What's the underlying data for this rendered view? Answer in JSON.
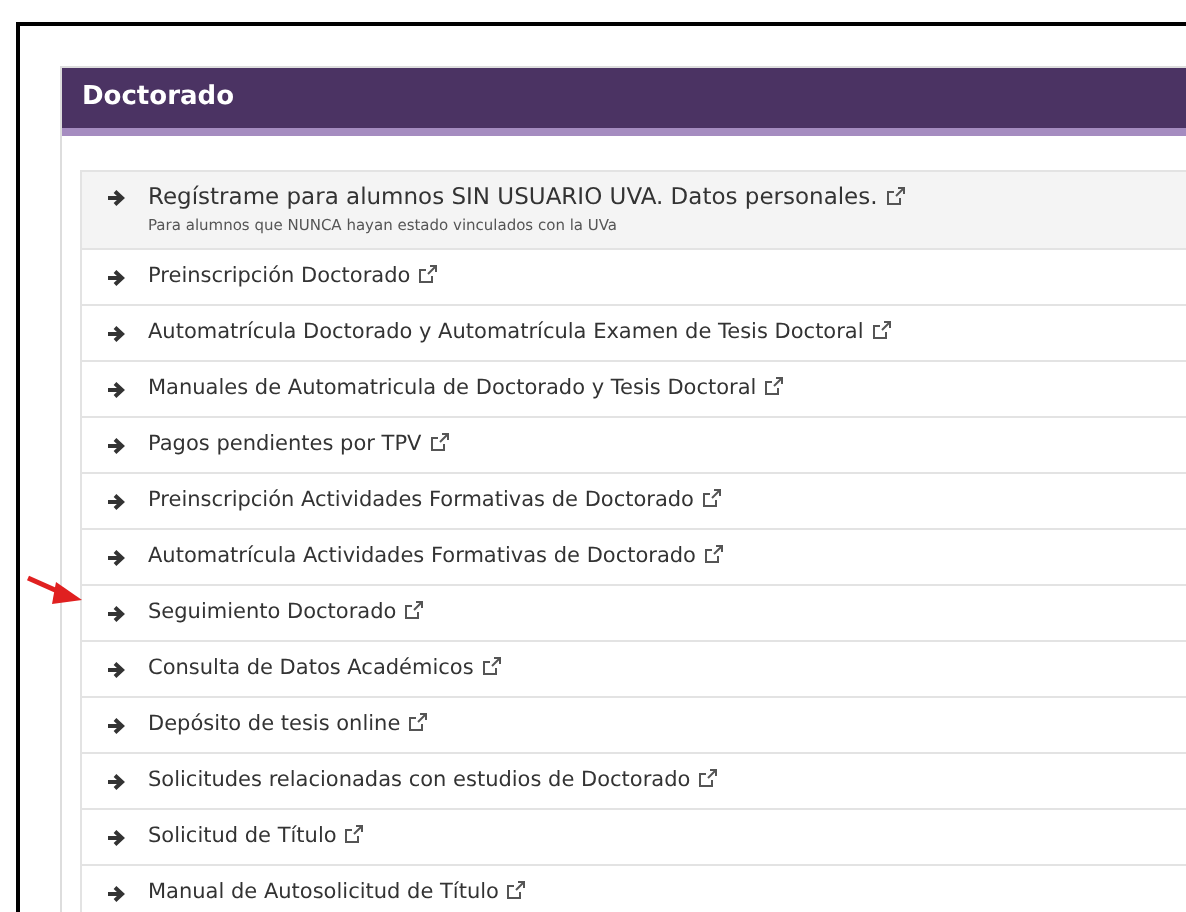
{
  "panel": {
    "title": "Doctorado"
  },
  "items": [
    {
      "label": "Regístrame para alumnos SIN USUARIO UVA. Datos personales.",
      "note": "Para alumnos que NUNCA hayan estado vinculados con la UVa",
      "highlighted": true
    },
    {
      "label": "Preinscripción Doctorado",
      "highlighted": false
    },
    {
      "label": "Automatrícula Doctorado y Automatrícula Examen de Tesis Doctoral",
      "highlighted": false
    },
    {
      "label": "Manuales de Automatricula de Doctorado y Tesis Doctoral",
      "highlighted": false
    },
    {
      "label": "Pagos pendientes por TPV",
      "highlighted": false
    },
    {
      "label": "Preinscripción Actividades Formativas de Doctorado",
      "highlighted": false
    },
    {
      "label": "Automatrícula Actividades Formativas de Doctorado",
      "highlighted": false
    },
    {
      "label": "Seguimiento Doctorado",
      "highlighted": false,
      "pointed": true
    },
    {
      "label": "Consulta de Datos Académicos",
      "highlighted": false
    },
    {
      "label": "Depósito de tesis online",
      "highlighted": false
    },
    {
      "label": "Solicitudes relacionadas con estudios de Doctorado",
      "highlighted": false
    },
    {
      "label": "Solicitud de Título",
      "highlighted": false
    },
    {
      "label": "Manual de Autosolicitud de Título",
      "highlighted": false
    }
  ]
}
